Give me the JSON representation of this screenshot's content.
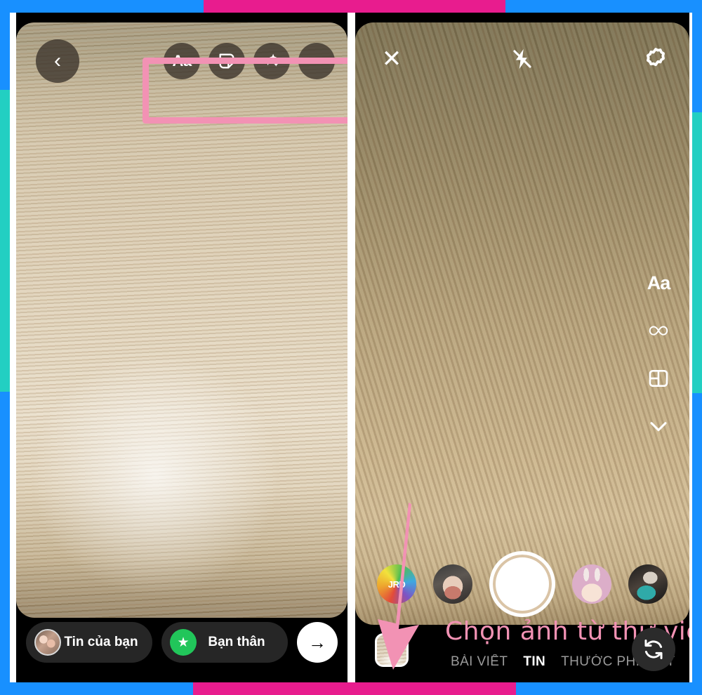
{
  "frame": {
    "colors": {
      "blue": "#1890FF",
      "magenta": "#E81C8E",
      "teal": "#22CFC2",
      "annotation_pink": "#F292B4"
    }
  },
  "left_panel": {
    "name": "instagram-story-editor",
    "top_bar": {
      "back_icon": "chevron-left-icon",
      "back_label": "‹",
      "tools": [
        {
          "name": "text-tool",
          "icon": "text-aa-icon",
          "label": "Aa"
        },
        {
          "name": "sticker-tool",
          "icon": "sticker-icon",
          "label": ""
        },
        {
          "name": "effects-tool",
          "icon": "sparkles-icon",
          "label": ""
        },
        {
          "name": "more-tool",
          "icon": "more-dots-icon",
          "label": "···"
        }
      ]
    },
    "highlight": {
      "label": "tools-highlight-box",
      "color": "#F292B4"
    },
    "bottom_bar": {
      "your_story_label": "Tin của bạn",
      "close_friends_label": "Bạn thân",
      "close_friends_icon": "green-star-icon",
      "close_friends_glyph": "★",
      "send_icon": "arrow-right-icon",
      "send_glyph": "→",
      "avatar_icon": "user-avatar"
    }
  },
  "right_panel": {
    "name": "instagram-story-camera",
    "top_bar": {
      "close_icon": "close-x-icon",
      "close_glyph": "✕",
      "flash_icon": "flash-off-icon",
      "settings_icon": "gear-icon"
    },
    "side_rail": [
      {
        "name": "text-tool",
        "icon": "text-aa-icon",
        "label": "Aa"
      },
      {
        "name": "boomerang-tool",
        "icon": "infinity-icon",
        "label": "∞"
      },
      {
        "name": "layout-tool",
        "icon": "layout-grid-icon",
        "label": ""
      },
      {
        "name": "more-tools-tool",
        "icon": "chevron-down-icon",
        "label": ""
      }
    ],
    "filters": [
      {
        "name": "filter-rainbow-jrd",
        "label": "JRD",
        "icon": "rainbow-filter-thumb"
      },
      {
        "name": "filter-portrait",
        "label": "",
        "icon": "portrait-filter-thumb"
      },
      {
        "name": "filter-bunny",
        "label": "",
        "icon": "bunny-filter-thumb"
      },
      {
        "name": "filter-sparkle",
        "label": "",
        "icon": "sparkle-filter-thumb"
      }
    ],
    "shutter": {
      "name": "shutter-button",
      "icon": "shutter-circle-icon"
    },
    "bottom_bar": {
      "gallery_thumb_icon": "gallery-thumbnail",
      "caption": "Chọn ảnh từ thư viện",
      "tabs": [
        {
          "label": "BÀI VIẾT",
          "active": false
        },
        {
          "label": "TIN",
          "active": true
        },
        {
          "label": "THƯỚC PHIM",
          "active": false
        },
        {
          "label": "TR",
          "active": false
        }
      ],
      "flip_camera_icon": "flip-camera-icon"
    },
    "annotation": {
      "name": "gallery-arrow-annotation",
      "icon": "down-arrow-icon",
      "color": "#F292B4"
    }
  }
}
